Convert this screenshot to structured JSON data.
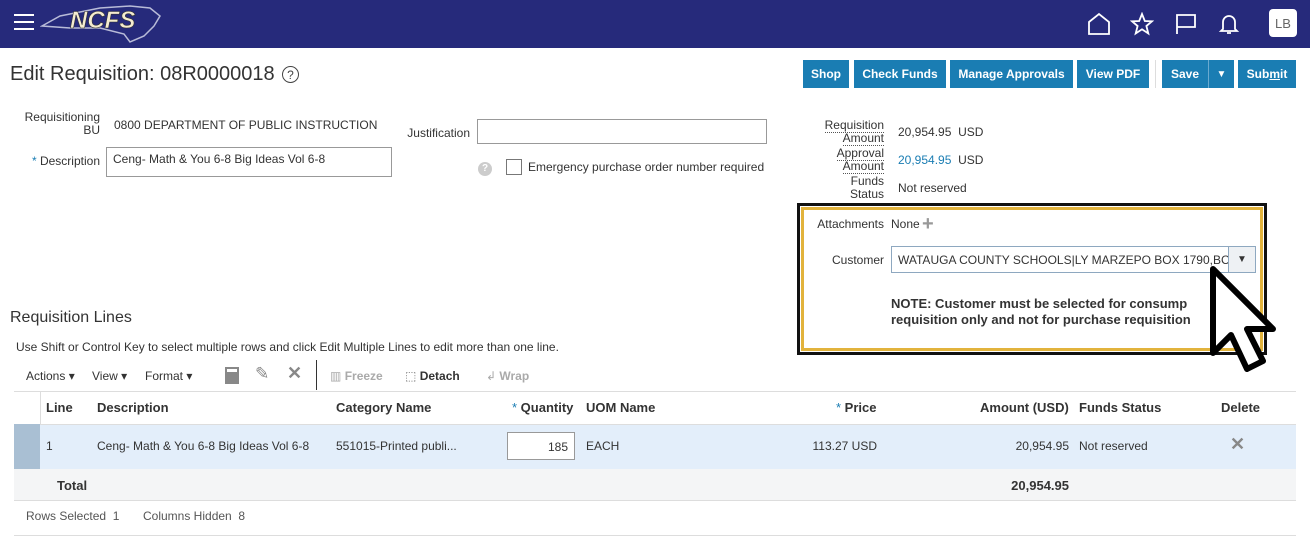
{
  "header": {
    "logo_text": "NCFS",
    "logo_subtitle": "North Carolina Financial System",
    "avatar": "LB",
    "icons": [
      "home-icon",
      "star-icon",
      "flag-icon",
      "bell-icon"
    ]
  },
  "page": {
    "title": "Edit Requisition: 08R0000018",
    "help": "?"
  },
  "actions": {
    "shop": "Shop",
    "check_funds": "Check Funds",
    "manage_approvals": "Manage Approvals",
    "view_pdf": "View PDF",
    "save": "Save",
    "submit_pre": "Sub",
    "submit_u": "m",
    "submit_post": "it"
  },
  "form": {
    "req_bu_label": "Requisitioning BU",
    "req_bu_value": "0800 DEPARTMENT OF PUBLIC INSTRUCTION",
    "description_label": "Description",
    "description_value": "Ceng- Math & You 6-8 Big Ideas Vol 6-8",
    "justification_label": "Justification",
    "justification_value": "",
    "emergency_label": "Emergency purchase order number required",
    "req_amount_label1": "Requisition",
    "req_amount_label2": "Amount",
    "req_amount_value": "20,954.95",
    "req_amount_currency": "USD",
    "approval_label1": "Approval",
    "approval_label2": "Amount",
    "approval_value": "20,954.95",
    "approval_currency": "USD",
    "funds_label1": "Funds",
    "funds_label2": "Status",
    "funds_value": "Not reserved",
    "attachments_label": "Attachments",
    "attachments_value": "None",
    "customer_label": "Customer",
    "customer_value": "WATAUGA COUNTY SCHOOLS|LY MARZEPO BOX 1790,BC",
    "note_line1": "NOTE: Customer must be selected for consump",
    "note_line2": "requisition only and not for purchase requisition"
  },
  "lines": {
    "title": "Requisition Lines",
    "hint": "Use Shift or Control Key to select multiple rows and click Edit Multiple Lines to edit more than one line.",
    "toolbar": {
      "actions": "Actions",
      "view": "View",
      "format": "Format",
      "freeze": "Freeze",
      "detach": "Detach",
      "wrap": "Wrap"
    },
    "columns": [
      "Line",
      "Description",
      "Category Name",
      "Quantity",
      "UOM Name",
      "Price",
      "Amount (USD)",
      "Funds Status",
      "Delete"
    ],
    "rows": [
      {
        "line": "1",
        "description": "Ceng- Math & You 6-8 Big Ideas Vol 6-8",
        "category": "551015-Printed publi...",
        "quantity": "185",
        "uom": "EACH",
        "price": "113.27 USD",
        "amount": "20,954.95",
        "funds_status": "Not reserved"
      }
    ],
    "total_label": "Total",
    "total_amount": "20,954.95",
    "rows_selected_label": "Rows Selected",
    "rows_selected": "1",
    "columns_hidden_label": "Columns Hidden",
    "columns_hidden": "8"
  }
}
